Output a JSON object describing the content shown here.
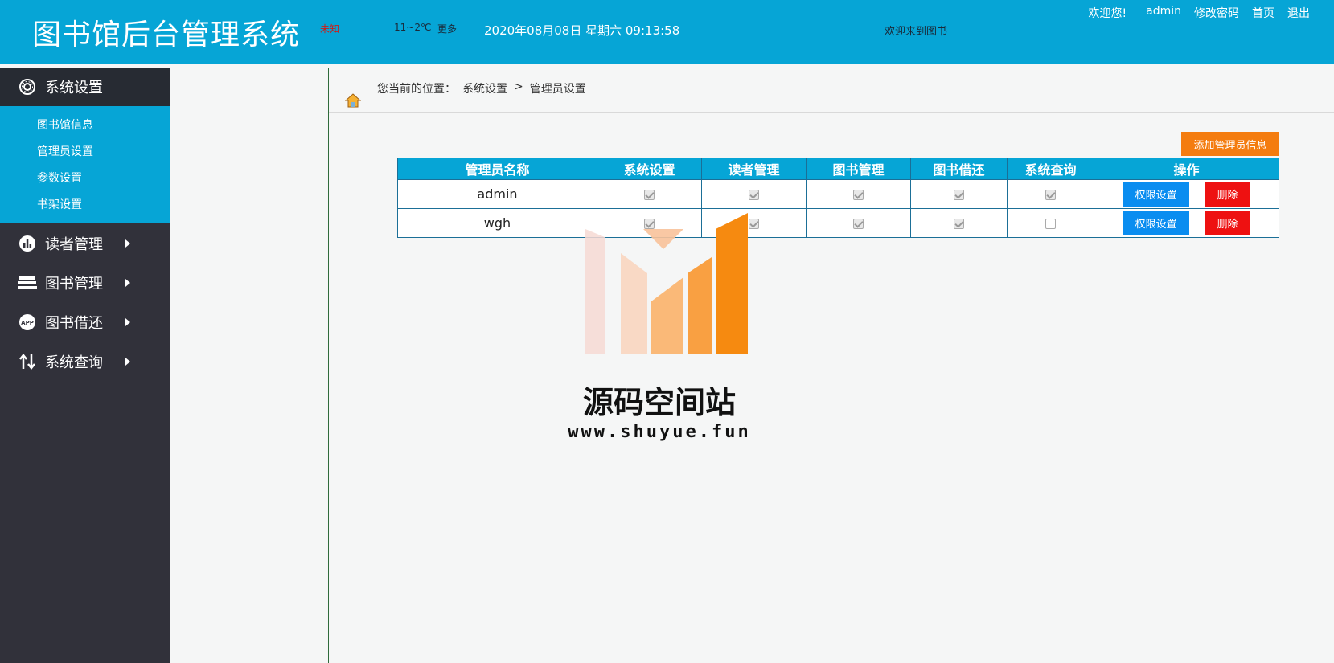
{
  "header": {
    "title": "图书馆后台管理系统",
    "weather_status": "未知",
    "weather_temp": "11~2℃",
    "weather_more": "更多",
    "datetime": "2020年08月08日 星期六 09:13:58",
    "marquee": "欢迎来到图书",
    "welcome": "欢迎您!",
    "user": "admin",
    "change_password": "修改密码",
    "home": "首页",
    "logout": "退出"
  },
  "sidebar": {
    "groups": [
      {
        "label": "系统设置",
        "icon": "gear-icon"
      },
      {
        "label": "读者管理",
        "icon": "bar-chart-icon"
      },
      {
        "label": "图书管理",
        "icon": "books-icon"
      },
      {
        "label": "图书借还",
        "icon": "app-icon"
      },
      {
        "label": "系统查询",
        "icon": "transfer-icon"
      }
    ],
    "sub_items": [
      "图书馆信息",
      "管理员设置",
      "参数设置",
      "书架设置"
    ]
  },
  "breadcrumb": {
    "prefix": "您当前的位置：",
    "level1": "系统设置",
    "separator": ">",
    "level2": "管理员设置"
  },
  "actions": {
    "add_admin": "添加管理员信息"
  },
  "table": {
    "headers": [
      "管理员名称",
      "系统设置",
      "读者管理",
      "图书管理",
      "图书借还",
      "系统查询",
      "操作"
    ],
    "rows": [
      {
        "name": "admin",
        "perms": [
          true,
          true,
          true,
          true,
          true
        ]
      },
      {
        "name": "wgh",
        "perms": [
          true,
          true,
          true,
          true,
          false
        ]
      }
    ],
    "perm_button": "权限设置",
    "delete_button": "删除"
  },
  "watermark": {
    "text": "源码空间站",
    "url": "www.shuyue.fun"
  },
  "colors": {
    "header_bg": "#06a5d6",
    "sidebar_bg": "#31313a",
    "add_button": "#f47c0f",
    "perm_button": "#0a8df0",
    "delete_button": "#ee1111"
  }
}
